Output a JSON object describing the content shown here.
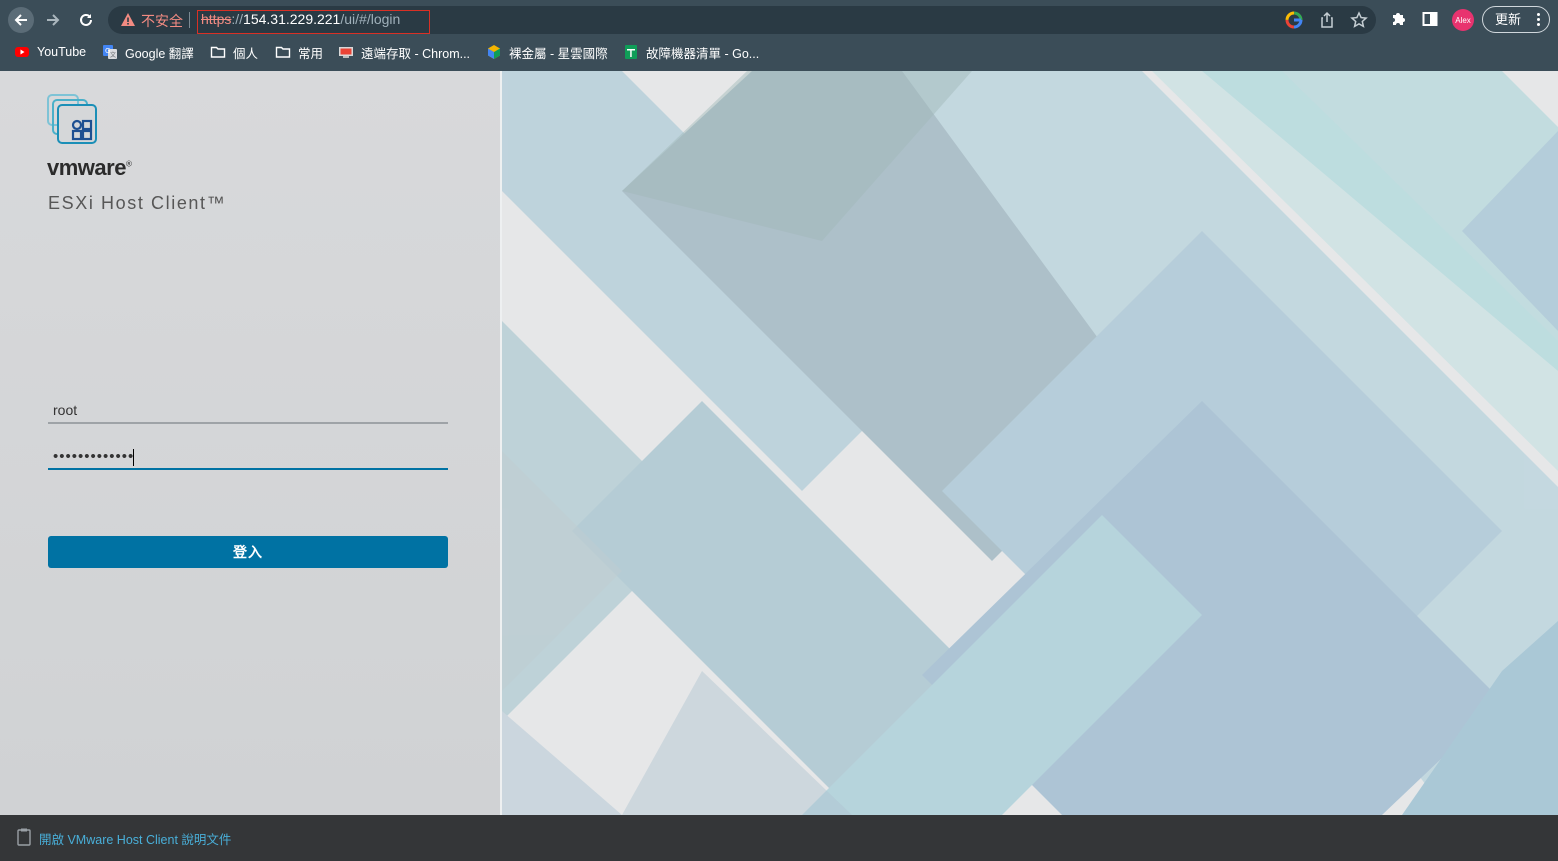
{
  "browser": {
    "insecure_label": "不安全",
    "url": {
      "scheme": "https",
      "separator": "://",
      "host": "154.31.229.221",
      "path": "/ui/#/login"
    },
    "profile_name": "Alex",
    "update_label": "更新",
    "bookmarks": [
      {
        "label": "YouTube",
        "icon": "youtube-icon"
      },
      {
        "label": "Google 翻譯",
        "icon": "google-translate-icon"
      },
      {
        "label": "個人",
        "icon": "folder-icon"
      },
      {
        "label": "常用",
        "icon": "folder-icon"
      },
      {
        "label": "遠端存取 - Chrom...",
        "icon": "remote-access-icon"
      },
      {
        "label": "裸金屬 - 星雲國際",
        "icon": "cube-icon"
      },
      {
        "label": "故障機器清單 - Go...",
        "icon": "sheets-icon"
      }
    ],
    "colors": {
      "chrome_bg": "#3b4d58",
      "omnibox_bg": "#2a3a44",
      "insecure": "#f28b82"
    }
  },
  "login": {
    "brand": "vmware",
    "trademark": "®",
    "product": "ESXi Host Client™",
    "username_value": "root",
    "password_value": "•••••••••••••",
    "login_button_label": "登入",
    "accent": "#0072a3"
  },
  "footer": {
    "help_link": "開啟 VMware Host Client 說明文件",
    "link_color": "#49afd9"
  }
}
